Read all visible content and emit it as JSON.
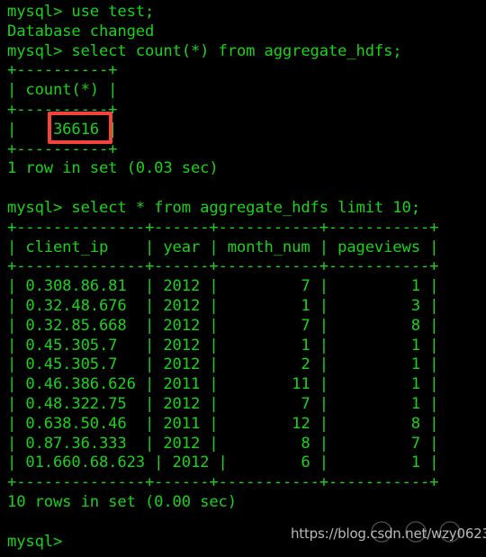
{
  "terminal": {
    "background_color": "#000000",
    "text_color": "#18d318",
    "highlight_color": "#f4433b",
    "lines": [
      "mysql> use test;",
      "Database changed",
      "mysql> select count(*) from aggregate_hdfs;",
      "+----------+",
      "| count(*) |",
      "+----------+",
      "|    36616 |",
      "+----------+",
      "1 row in set (0.03 sec)",
      "",
      "mysql> select * from aggregate_hdfs limit 10;",
      "+--------------+------+-----------+-----------+",
      "| client_ip    | year | month_num | pageviews |",
      "+--------------+------+-----------+-----------+",
      "| 0.308.86.81  | 2012 |         7 |         1 |",
      "| 0.32.48.676  | 2012 |         1 |         3 |",
      "| 0.32.85.668  | 2012 |         7 |         8 |",
      "| 0.45.305.7   | 2012 |         1 |         1 |",
      "| 0.45.305.7   | 2012 |         2 |         1 |",
      "| 0.46.386.626 | 2011 |        11 |         1 |",
      "| 0.48.322.75  | 2012 |         7 |         1 |",
      "| 0.638.50.46  | 2011 |        12 |         8 |",
      "| 0.87.36.333  | 2012 |         8 |         7 |",
      "| 01.660.68.623 | 2012 |        6 |         1 |",
      "+--------------+------+-----------+-----------+",
      "10 rows in set (0.00 sec)",
      "",
      "mysql>"
    ],
    "commands": [
      {
        "prompt": "mysql>",
        "text": "use test;"
      },
      {
        "prompt": "mysql>",
        "text": "select count(*) from aggregate_hdfs;"
      },
      {
        "prompt": "mysql>",
        "text": "select * from aggregate_hdfs limit 10;"
      },
      {
        "prompt": "mysql>",
        "text": ""
      }
    ],
    "messages": {
      "database_changed": "Database changed",
      "count_result_status": "1 row in set (0.03 sec)",
      "select_result_status": "10 rows in set (0.00 sec)"
    },
    "count_table": {
      "separator": "+----------+",
      "header": "| count(*) |",
      "header_label": "count(*)",
      "value": "36616",
      "value_row": "|    36616 |",
      "highlighted": true
    },
    "rows_table": {
      "separator": "+--------------+------+-----------+-----------+",
      "header_row": "| client_ip    | year | month_num | pageviews |",
      "columns": [
        "client_ip",
        "year",
        "month_num",
        "pageviews"
      ],
      "rows": [
        [
          "0.308.86.81",
          "2012",
          "7",
          "1"
        ],
        [
          "0.32.48.676",
          "2012",
          "1",
          "3"
        ],
        [
          "0.32.85.668",
          "2012",
          "7",
          "8"
        ],
        [
          "0.45.305.7",
          "2012",
          "1",
          "1"
        ],
        [
          "0.45.305.7",
          "2012",
          "2",
          "1"
        ],
        [
          "0.46.386.626",
          "2011",
          "11",
          "1"
        ],
        [
          "0.48.322.75",
          "2012",
          "7",
          "1"
        ],
        [
          "0.638.50.46",
          "2011",
          "12",
          "8"
        ],
        [
          "0.87.36.333",
          "2012",
          "8",
          "7"
        ],
        [
          "01.660.68.623",
          "2012",
          "6",
          "1"
        ]
      ]
    }
  },
  "watermark": {
    "text": "https://blog.csdn.net/wzy0623"
  }
}
